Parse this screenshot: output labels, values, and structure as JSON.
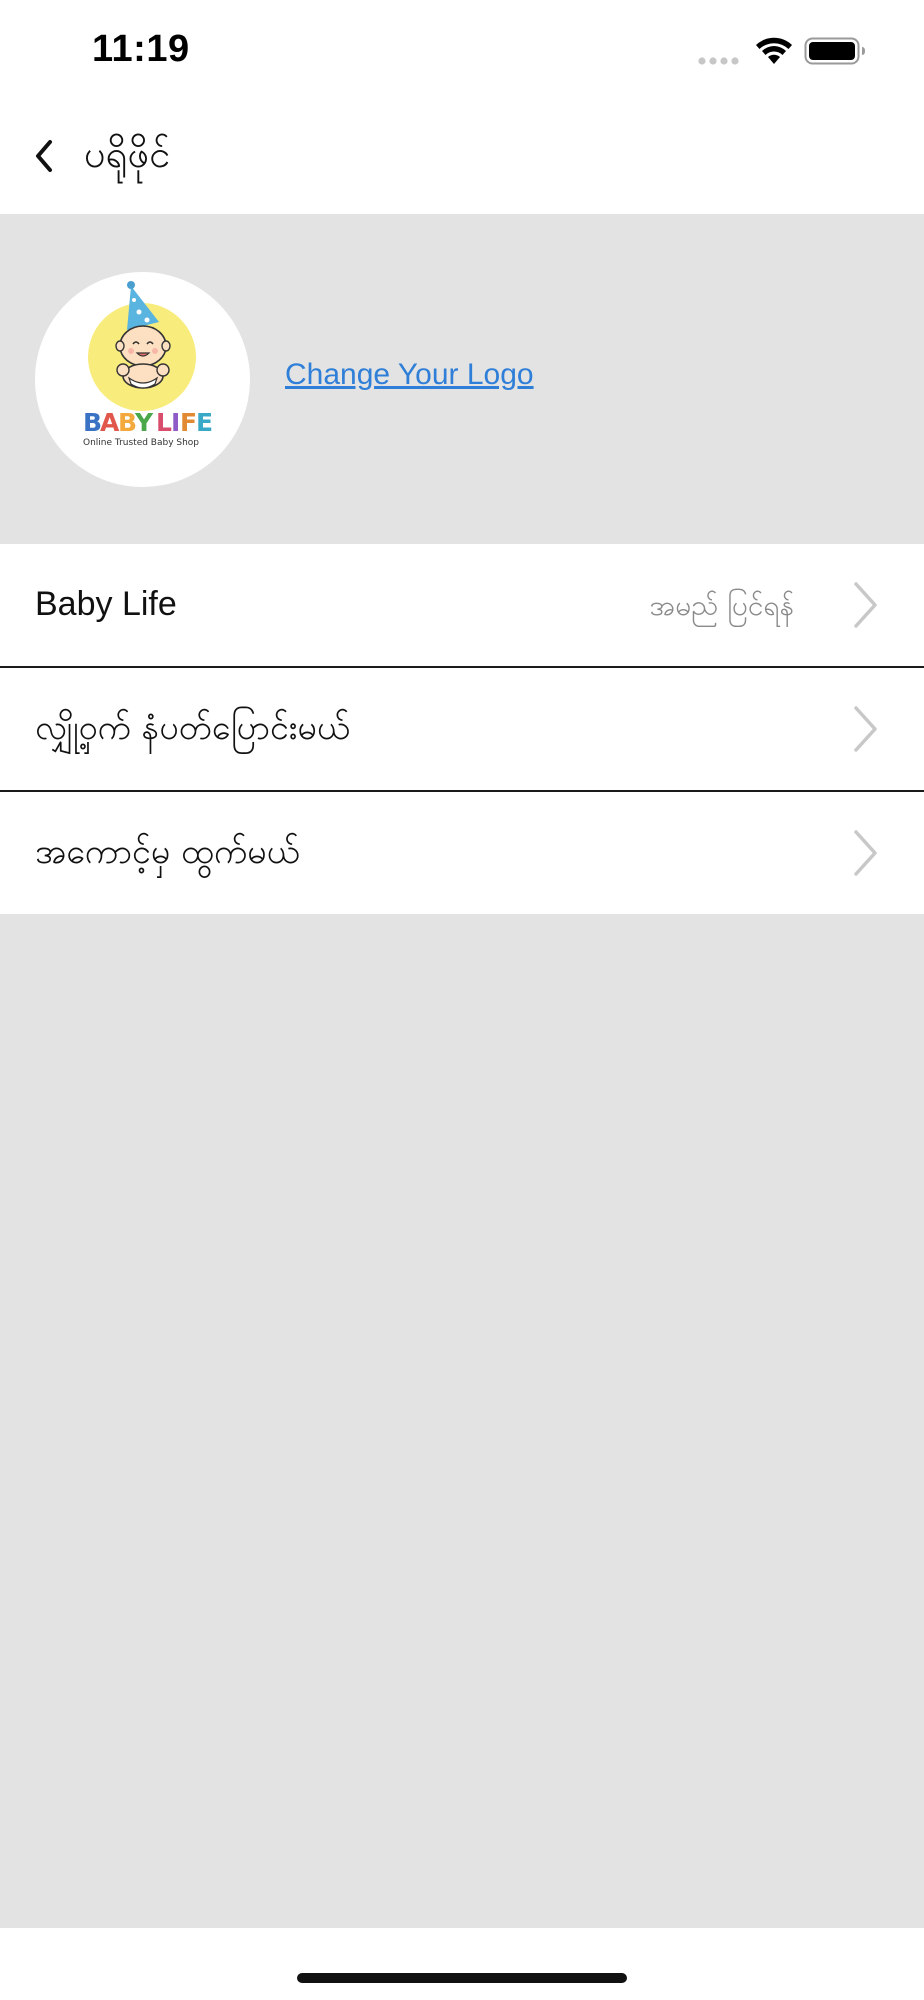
{
  "status_bar": {
    "time": "11:19"
  },
  "nav": {
    "title": "ပရိုဖိုင်",
    "back_icon": "chevron-left-icon"
  },
  "logo_section": {
    "logo_brand": "BABY LIFE",
    "logo_tagline": "Online Trusted Baby Shop",
    "change_logo_label": "Change Your Logo"
  },
  "menu": {
    "items": [
      {
        "label": "Baby Life",
        "value": "အမည် ပြင်ရန်",
        "icon": "chevron-right-icon"
      },
      {
        "label": "လျှို့ဝှက် နံပတ်ပြောင်းမယ်",
        "value": "",
        "icon": "chevron-right-icon"
      },
      {
        "label": "အကောင့်မှ ထွက်မယ်",
        "value": "",
        "icon": "chevron-right-icon"
      }
    ]
  },
  "colors": {
    "link": "#2f7fd8",
    "background": "#e3e3e3",
    "logo_yellow": "#f8ec7c"
  }
}
